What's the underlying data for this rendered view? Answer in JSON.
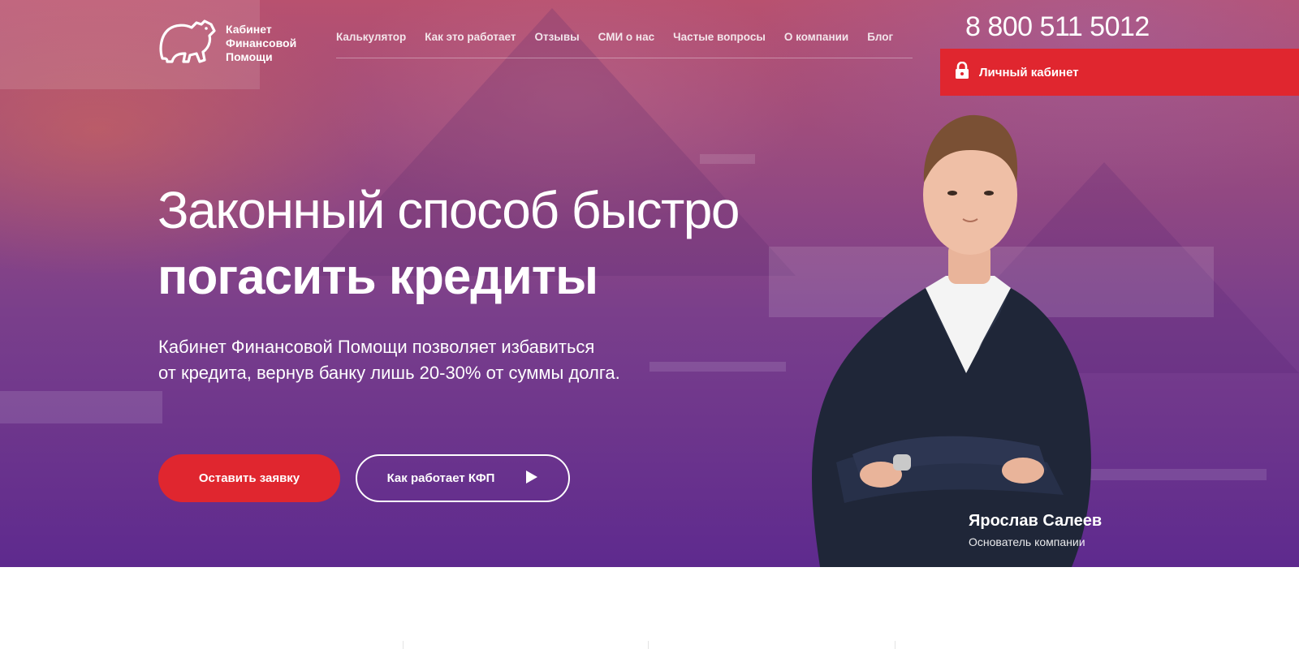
{
  "brand": {
    "name_lines": [
      "Кабинет",
      "Финансовой",
      "Помощи"
    ]
  },
  "nav": [
    {
      "label": "Калькулятор"
    },
    {
      "label": "Как это работает"
    },
    {
      "label": "Отзывы"
    },
    {
      "label": "СМИ о нас"
    },
    {
      "label": "Частые вопросы"
    },
    {
      "label": "О компании"
    },
    {
      "label": "Блог"
    }
  ],
  "header": {
    "phone": "8 800 511 5012",
    "cabinet_label": "Личный кабинет"
  },
  "hero": {
    "title_line1": "Законный способ быстро",
    "title_line2": "погасить кредиты",
    "lead_line1": "Кабинет Финансовой Помощи позволяет избавиться",
    "lead_line2": "от кредита, вернув банку лишь 20-30% от суммы долга.",
    "cta_primary": "Оставить заявку",
    "cta_secondary": "Как работает КФП"
  },
  "founder": {
    "name": "Ярослав Салеев",
    "role": "Основатель компании"
  },
  "colors": {
    "accent": "#e0262f",
    "hero_top": "#b8516f",
    "hero_bottom": "#5e2a8e"
  },
  "icons": [
    "bear-logo-icon",
    "lock-icon",
    "play-icon"
  ]
}
